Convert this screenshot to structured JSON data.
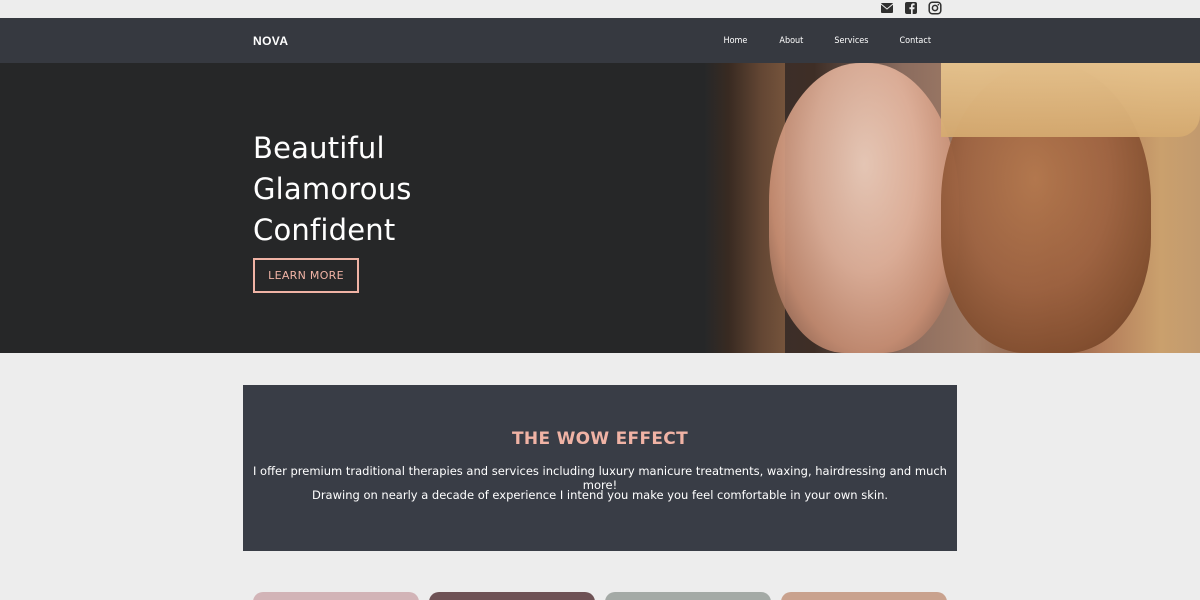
{
  "social": {
    "icons": [
      "envelope-icon",
      "facebook-square-icon",
      "instagram-icon"
    ]
  },
  "brand": "NOVA",
  "nav": {
    "home": "Home",
    "about": "About",
    "services": "Services",
    "contact": "Contact"
  },
  "hero": {
    "lines": [
      "Beautiful",
      "Glamorous",
      "Confident"
    ],
    "cta": "LEARN MORE"
  },
  "wow": {
    "title": "THE WOW EFFECT",
    "p1": "I offer premium traditional therapies and services including luxury manicure treatments, waxing, hairdressing and much more!",
    "p2": "Drawing on nearly a decade of experience I intend you make you feel comfortable in your own skin."
  },
  "colors": {
    "accent": "#f0b3a5",
    "navbar": "#363940",
    "panel": "#393d46",
    "background": "#ededed"
  }
}
